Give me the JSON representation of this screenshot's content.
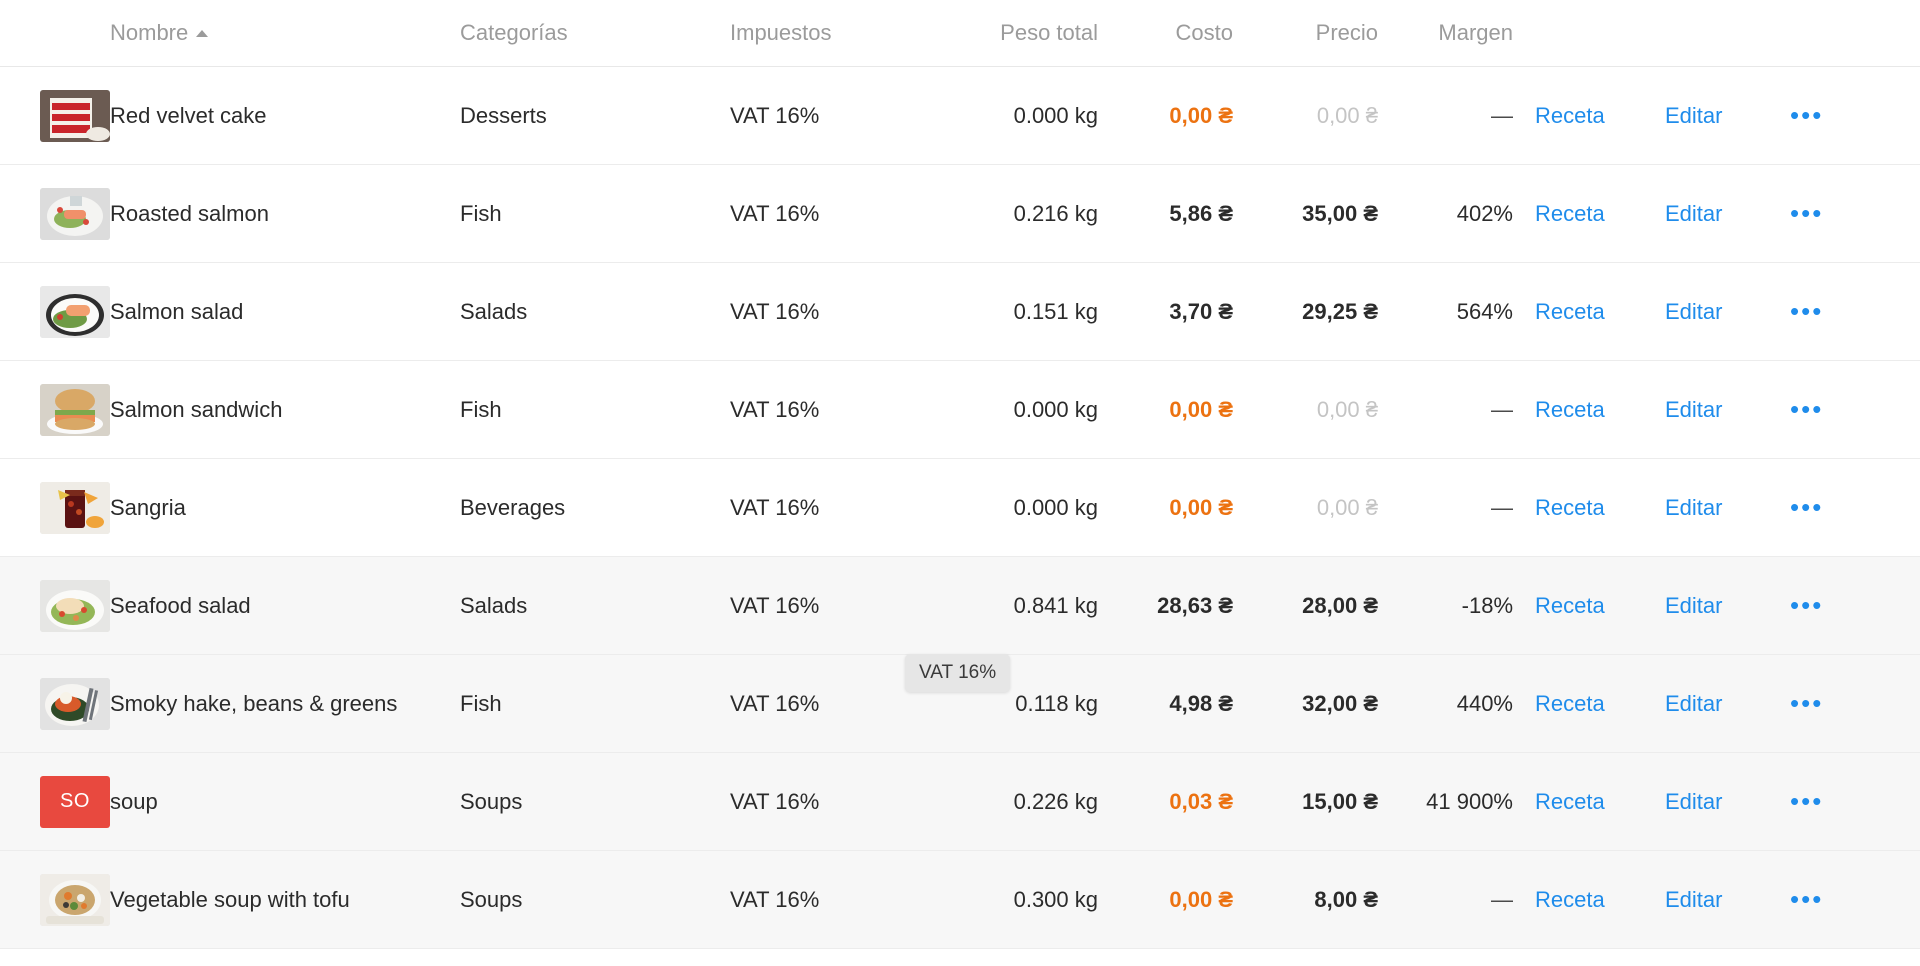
{
  "table": {
    "columns": [
      {
        "key": "image",
        "label": "",
        "align": "left"
      },
      {
        "key": "name",
        "label": "Nombre",
        "align": "left",
        "sorted": "asc"
      },
      {
        "key": "category",
        "label": "Categorías",
        "align": "left"
      },
      {
        "key": "tax",
        "label": "Impuestos",
        "align": "left"
      },
      {
        "key": "weight",
        "label": "Peso total",
        "align": "right"
      },
      {
        "key": "cost",
        "label": "Costo",
        "align": "right"
      },
      {
        "key": "price",
        "label": "Precio",
        "align": "right"
      },
      {
        "key": "margin",
        "label": "Margen",
        "align": "right"
      },
      {
        "key": "recipe",
        "label": "",
        "align": "left"
      },
      {
        "key": "edit",
        "label": "",
        "align": "left"
      },
      {
        "key": "more",
        "label": "",
        "align": "left"
      }
    ],
    "header": {
      "name": "Nombre",
      "category": "Categorías",
      "tax": "Impuestos",
      "weight": "Peso total",
      "cost": "Costo",
      "price": "Precio",
      "margin": "Margen",
      "sort_icon": "sort-ascending-icon"
    },
    "actions": {
      "recipe_label": "Receta",
      "edit_label": "Editar",
      "more_label": "•••"
    },
    "rows": [
      {
        "image_type": "photo",
        "photo": "red-velvet-cake",
        "name": "Red velvet cake",
        "category": "Desserts",
        "tax": "VAT 16%",
        "weight": "0.000 kg",
        "cost": "0,00 ₴",
        "cost_state": "zero",
        "price": "0,00 ₴",
        "price_state": "muted",
        "margin": "—",
        "highlighted": false
      },
      {
        "image_type": "photo",
        "photo": "roasted-salmon",
        "name": "Roasted salmon",
        "category": "Fish",
        "tax": "VAT 16%",
        "weight": "0.216 kg",
        "cost": "5,86 ₴",
        "cost_state": "normal",
        "price": "35,00 ₴",
        "price_state": "normal",
        "margin": "402%",
        "highlighted": false
      },
      {
        "image_type": "photo",
        "photo": "salmon-salad",
        "name": "Salmon salad",
        "category": "Salads",
        "tax": "VAT 16%",
        "weight": "0.151 kg",
        "cost": "3,70 ₴",
        "cost_state": "normal",
        "price": "29,25 ₴",
        "price_state": "normal",
        "margin": "564%",
        "highlighted": false
      },
      {
        "image_type": "photo",
        "photo": "salmon-sandwich",
        "name": "Salmon sandwich",
        "category": "Fish",
        "tax": "VAT 16%",
        "weight": "0.000 kg",
        "cost": "0,00 ₴",
        "cost_state": "zero",
        "price": "0,00 ₴",
        "price_state": "muted",
        "margin": "—",
        "highlighted": false
      },
      {
        "image_type": "photo",
        "photo": "sangria",
        "name": "Sangria",
        "category": "Beverages",
        "tax": "VAT 16%",
        "weight": "0.000 kg",
        "cost": "0,00 ₴",
        "cost_state": "zero",
        "price": "0,00 ₴",
        "price_state": "muted",
        "margin": "—",
        "highlighted": false
      },
      {
        "image_type": "photo",
        "photo": "seafood-salad",
        "name": "Seafood salad",
        "category": "Salads",
        "tax": "VAT 16%",
        "weight": "0.841 kg",
        "cost": "28,63 ₴",
        "cost_state": "normal",
        "price": "28,00 ₴",
        "price_state": "normal",
        "margin": "-18%",
        "highlighted": true
      },
      {
        "image_type": "photo",
        "photo": "smoky-hake",
        "name": "Smoky hake, beans & greens",
        "category": "Fish",
        "tax": "VAT 16%",
        "weight": "0.118 kg",
        "cost": "4,98 ₴",
        "cost_state": "normal",
        "price": "32,00 ₴",
        "price_state": "normal",
        "margin": "440%",
        "highlighted": true
      },
      {
        "image_type": "initials",
        "initials": "SO",
        "initials_color": "#e8493f",
        "name": "soup",
        "category": "Soups",
        "tax": "VAT 16%",
        "weight": "0.226 kg",
        "cost": "0,03 ₴",
        "cost_state": "zero",
        "price": "15,00 ₴",
        "price_state": "normal",
        "margin": "41 900%",
        "highlighted": true
      },
      {
        "image_type": "photo",
        "photo": "vegetable-soup-tofu",
        "name": "Vegetable soup with tofu",
        "category": "Soups",
        "tax": "VAT 16%",
        "weight": "0.300 kg",
        "cost": "0,00 ₴",
        "cost_state": "zero",
        "price": "8,00 ₴",
        "price_state": "normal",
        "margin": "—",
        "highlighted": true
      }
    ]
  },
  "tooltip": {
    "text": "VAT 16%"
  },
  "colors": {
    "link": "#1f8ceb",
    "zero_cost": "#ec7211",
    "muted": "#c4c4c4",
    "header_text": "#9b9b9b",
    "row_highlight": "#f7f7f7",
    "initials_badge": "#e8493f"
  }
}
